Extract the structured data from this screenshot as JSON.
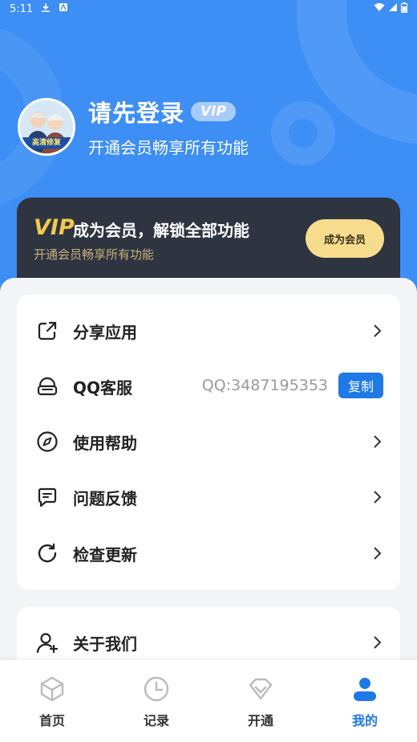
{
  "status_bar": {
    "time": "5:11"
  },
  "profile": {
    "title": "请先登录",
    "vip_badge": "VIP",
    "subtitle": "开通会员畅享所有功能",
    "avatar_band": "高清修复"
  },
  "vip_card": {
    "vip_word": "VIP",
    "title": "成为会员，解锁全部功能",
    "subtitle": "开通会员畅享所有功能",
    "button": "成为会员"
  },
  "menu": {
    "share": "分享应用",
    "qq": "QQ客服",
    "qq_number": "QQ:3487195353",
    "copy": "复制",
    "help": "使用帮助",
    "feedback": "问题反馈",
    "update": "检查更新",
    "about": "关于我们"
  },
  "tabs": [
    {
      "label": "首页",
      "icon": "cube-icon"
    },
    {
      "label": "记录",
      "icon": "clock-icon"
    },
    {
      "label": "开通",
      "icon": "diamond-icon"
    },
    {
      "label": "我的",
      "icon": "person-icon"
    }
  ],
  "colors": {
    "header_blue": "#3d8ef5",
    "accent_blue": "#1e78e6",
    "vip_gold": "#f2c84b",
    "vip_card_bg": "#2e3440"
  }
}
